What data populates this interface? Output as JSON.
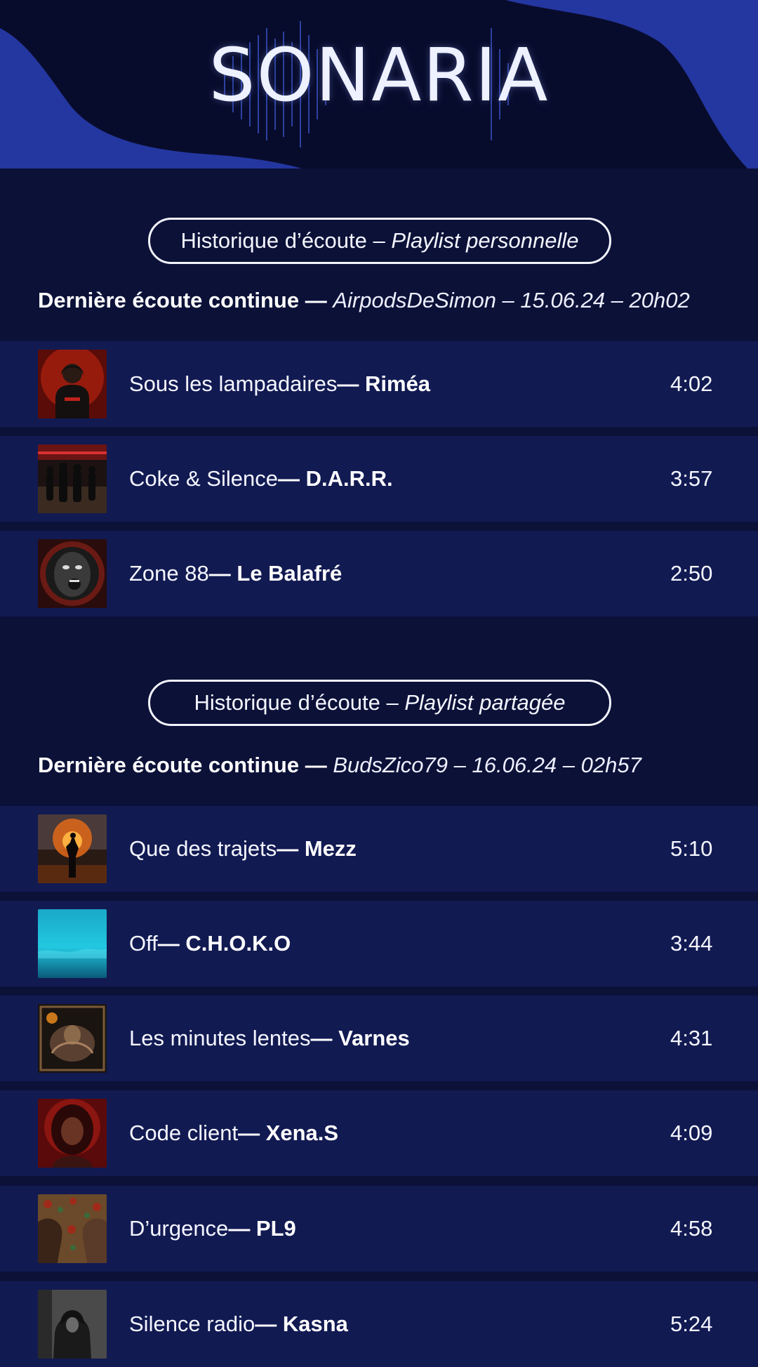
{
  "app": {
    "logo": "SONARIA"
  },
  "sections": [
    {
      "pill_prefix": "Historique d’écoute – ",
      "pill_emphasis": "Playlist personnelle",
      "last_label": "Dernière écoute continue — ",
      "last_detail": "AirpodsDeSimon – 15.06.24 – 20h02",
      "tracks": [
        {
          "title": "Sous les lampadaires",
          "artist": " — Riméa",
          "duration": "4:02",
          "cover": "hooded-figure-red-cover"
        },
        {
          "title": "Coke & Silence",
          "artist": " — D.A.R.R.",
          "duration": "3:57",
          "cover": "night-street-crowd-cover"
        },
        {
          "title": "Zone 88",
          "artist": " — Le Balafré",
          "duration": "2:50",
          "cover": "screaming-face-cover"
        }
      ]
    },
    {
      "pill_prefix": "Historique d’écoute – ",
      "pill_emphasis": "Playlist partagée",
      "last_label": "Dernière écoute continue — ",
      "last_detail": "BudsZico79 – 16.06.24 – 02h57",
      "tracks": [
        {
          "title": "Que des trajets",
          "artist": " — Mezz",
          "duration": "5:10",
          "cover": "fire-silhouette-cover"
        },
        {
          "title": "Off",
          "artist": " — C.H.O.K.O",
          "duration": "3:44",
          "cover": "underwater-cover"
        },
        {
          "title": "Les minutes lentes",
          "artist": " — Varnes",
          "duration": "4:31",
          "cover": "ornate-engraving-cover"
        },
        {
          "title": "Code client",
          "artist": " — Xena.S",
          "duration": "4:09",
          "cover": "woman-portrait-red-cover"
        },
        {
          "title": "D’urgence",
          "artist": " — PL9",
          "duration": "4:58",
          "cover": "two-faces-floral-cover"
        },
        {
          "title": "Silence radio",
          "artist": " — Kasna",
          "duration": "5:24",
          "cover": "hooded-figure-grey-cover"
        }
      ]
    }
  ],
  "colors": {
    "background": "#0c1138",
    "row": "#121a52",
    "header_wave": "#2436a0",
    "text": "#ffffff"
  }
}
